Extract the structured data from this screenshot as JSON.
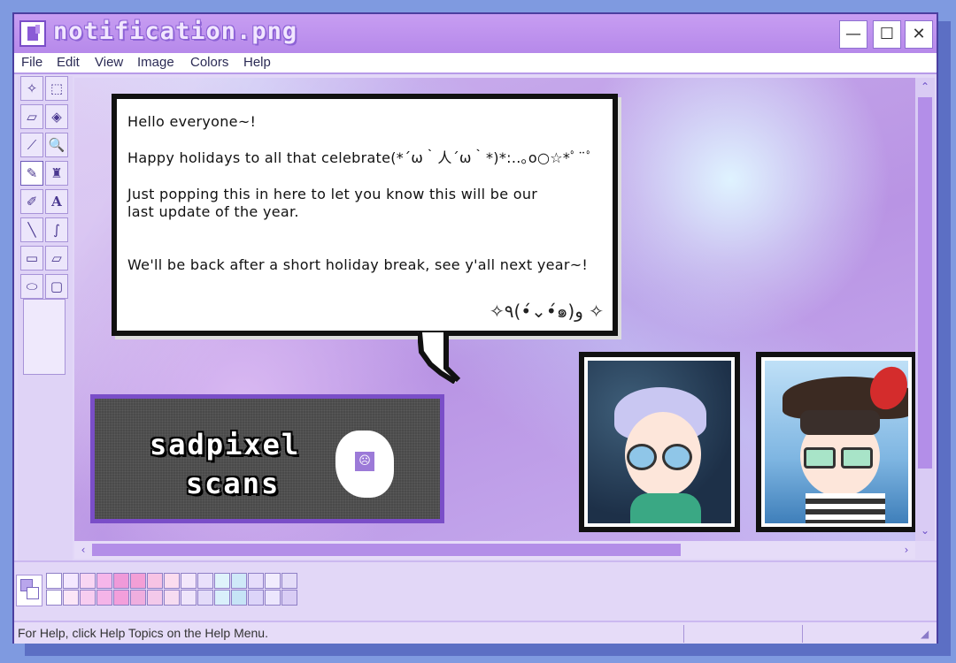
{
  "window": {
    "title": "notification.png"
  },
  "window_controls": {
    "minimize": "—",
    "maximize": "☐",
    "close": "✕"
  },
  "menu": [
    "File",
    "Edit",
    "View",
    "Image",
    "Colors",
    "Help"
  ],
  "tools": [
    {
      "name": "free-select",
      "glyph": "✧"
    },
    {
      "name": "rect-select",
      "glyph": "⬚"
    },
    {
      "name": "eraser",
      "glyph": "▱"
    },
    {
      "name": "fill",
      "glyph": "◈"
    },
    {
      "name": "eyedropper",
      "glyph": "⟋"
    },
    {
      "name": "magnifier",
      "glyph": "🔍"
    },
    {
      "name": "pencil",
      "glyph": "✎"
    },
    {
      "name": "brush",
      "glyph": "♜"
    },
    {
      "name": "airbrush",
      "glyph": "✐"
    },
    {
      "name": "text",
      "glyph": "A"
    },
    {
      "name": "line",
      "glyph": "╲"
    },
    {
      "name": "curve",
      "glyph": "∫"
    },
    {
      "name": "rectangle",
      "glyph": "▭"
    },
    {
      "name": "polygon",
      "glyph": "▱"
    },
    {
      "name": "ellipse",
      "glyph": "⬭"
    },
    {
      "name": "rounded-rect",
      "glyph": "▢"
    }
  ],
  "bubble": {
    "line1": "Hello everyone~!",
    "line2": "Happy holidays to all that celebrate(*´ω｀人´ω｀*)*:..｡o○☆*ﾟ¨ﾟ",
    "line3a": "Just popping this in here to let you know this will be our",
    "line3b": "last update of the year.",
    "line4": "We'll be back after a short holiday break, see y'all next year~!",
    "signature": "✧٩(•́⌄•́๑)و ✧"
  },
  "banner": {
    "line1": "sadpixel",
    "line2": "scans",
    "face": "☹"
  },
  "palette": {
    "row1": [
      "#ffffff",
      "#f4e8ff",
      "#f8d6f3",
      "#f6b6ea",
      "#ef9ad9",
      "#f39fd6",
      "#f7c3e4",
      "#fbdcef",
      "#f3e7fb",
      "#e9e0fb",
      "#dff3fb",
      "#cfe9f8",
      "#e6dcfb",
      "#f1ecfd",
      "#e4dcf8"
    ],
    "row2": [
      "#ffffff",
      "#fbe6f7",
      "#f7cdf0",
      "#f4b4e8",
      "#f39fdb",
      "#efaedf",
      "#f3c9ea",
      "#f6dcf1",
      "#efe5fb",
      "#e3dbf9",
      "#d9f0fb",
      "#c6e4f6",
      "#dcd4f9",
      "#ece6fd",
      "#d9cdf5"
    ]
  },
  "status": {
    "help_text": "For Help, click Help Topics on the Help Menu."
  },
  "scroll": {
    "up": "⌃",
    "down": "⌄",
    "left": "‹",
    "right": "›"
  }
}
